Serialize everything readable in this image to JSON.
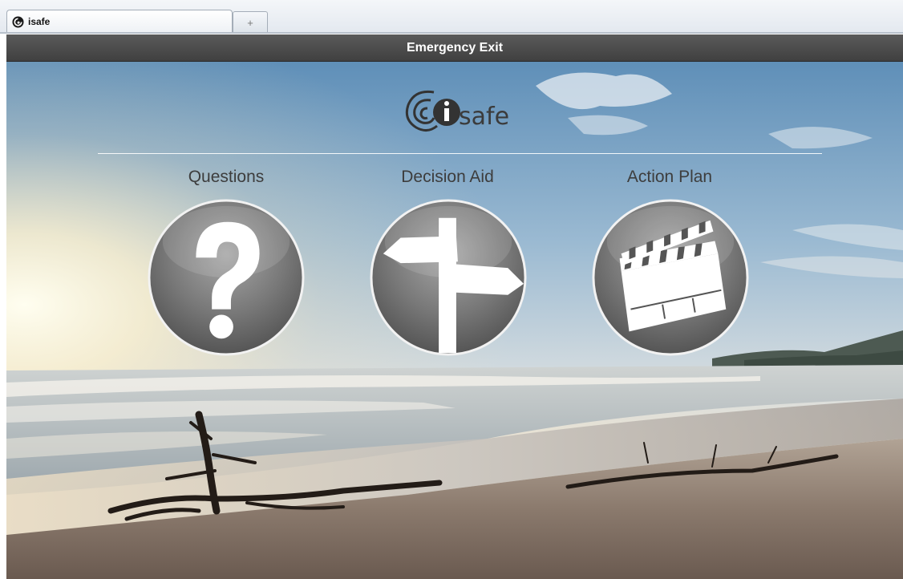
{
  "tab": {
    "title": "isafe",
    "new_tab_label": "+"
  },
  "header": {
    "emergency_exit": "Emergency Exit"
  },
  "logo": {
    "text": "safe"
  },
  "menu": [
    {
      "label": "Questions",
      "icon": "question-mark-icon"
    },
    {
      "label": "Decision Aid",
      "icon": "signpost-icon"
    },
    {
      "label": "Action Plan",
      "icon": "clapperboard-icon"
    }
  ]
}
